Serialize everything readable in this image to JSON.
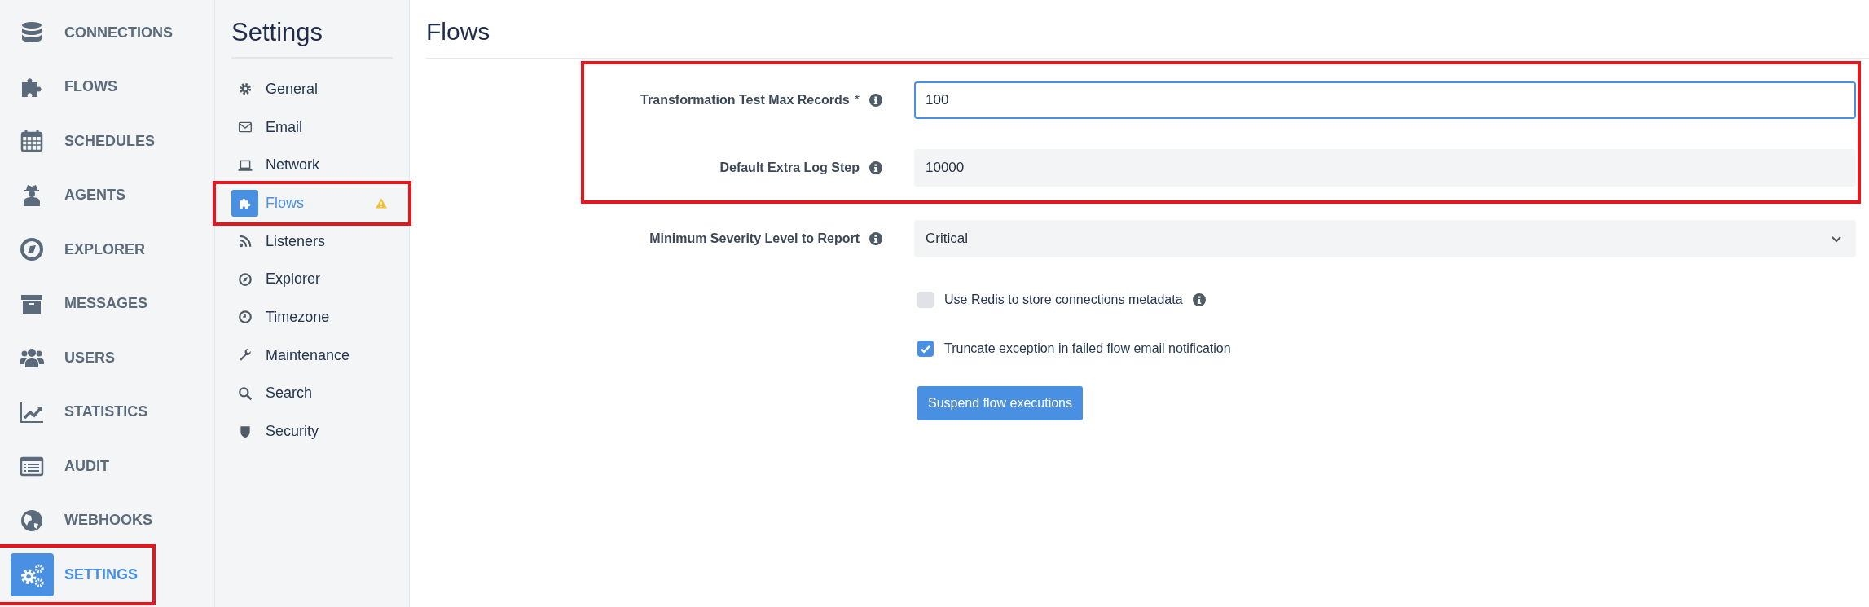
{
  "nav": {
    "items": [
      {
        "label": "CONNECTIONS",
        "selected": false,
        "highlighted": false
      },
      {
        "label": "FLOWS",
        "selected": false,
        "highlighted": false
      },
      {
        "label": "SCHEDULES",
        "selected": false,
        "highlighted": false
      },
      {
        "label": "AGENTS",
        "selected": false,
        "highlighted": false
      },
      {
        "label": "EXPLORER",
        "selected": false,
        "highlighted": false
      },
      {
        "label": "MESSAGES",
        "selected": false,
        "highlighted": false
      },
      {
        "label": "USERS",
        "selected": false,
        "highlighted": false
      },
      {
        "label": "STATISTICS",
        "selected": false,
        "highlighted": false
      },
      {
        "label": "AUDIT",
        "selected": false,
        "highlighted": false
      },
      {
        "label": "WEBHOOKS",
        "selected": false,
        "highlighted": false
      },
      {
        "label": "SETTINGS",
        "selected": true,
        "highlighted": true
      }
    ]
  },
  "settings_nav": {
    "title": "Settings",
    "items": [
      {
        "label": "General",
        "selected": false,
        "highlighted": false,
        "warning": false
      },
      {
        "label": "Email",
        "selected": false,
        "highlighted": false,
        "warning": false
      },
      {
        "label": "Network",
        "selected": false,
        "highlighted": false,
        "warning": false
      },
      {
        "label": "Flows",
        "selected": true,
        "highlighted": true,
        "warning": true
      },
      {
        "label": "Listeners",
        "selected": false,
        "highlighted": false,
        "warning": false
      },
      {
        "label": "Explorer",
        "selected": false,
        "highlighted": false,
        "warning": false
      },
      {
        "label": "Timezone",
        "selected": false,
        "highlighted": false,
        "warning": false
      },
      {
        "label": "Maintenance",
        "selected": false,
        "highlighted": false,
        "warning": false
      },
      {
        "label": "Search",
        "selected": false,
        "highlighted": false,
        "warning": false
      },
      {
        "label": "Security",
        "selected": false,
        "highlighted": false,
        "warning": false
      }
    ]
  },
  "page": {
    "title": "Flows"
  },
  "form": {
    "groups": [
      {
        "highlighted": true,
        "fields": [
          {
            "kind": "input",
            "label": "Transformation Test Max Records",
            "required_mark": "*",
            "value": "100",
            "focused": true
          },
          {
            "kind": "input",
            "label": "Default Extra Log Step",
            "value": "10000",
            "focused": false
          }
        ]
      },
      {
        "highlighted": false,
        "fields": [
          {
            "kind": "select",
            "label": "Minimum Severity Level to Report",
            "value": "Critical",
            "focused": false
          }
        ]
      }
    ],
    "checkboxes": [
      {
        "label": "Use Redis to store connections metadata",
        "checked": false,
        "info": true
      },
      {
        "label": "Truncate exception in failed flow email notification",
        "checked": true,
        "info": false
      }
    ],
    "button": "Suspend flow executions"
  }
}
